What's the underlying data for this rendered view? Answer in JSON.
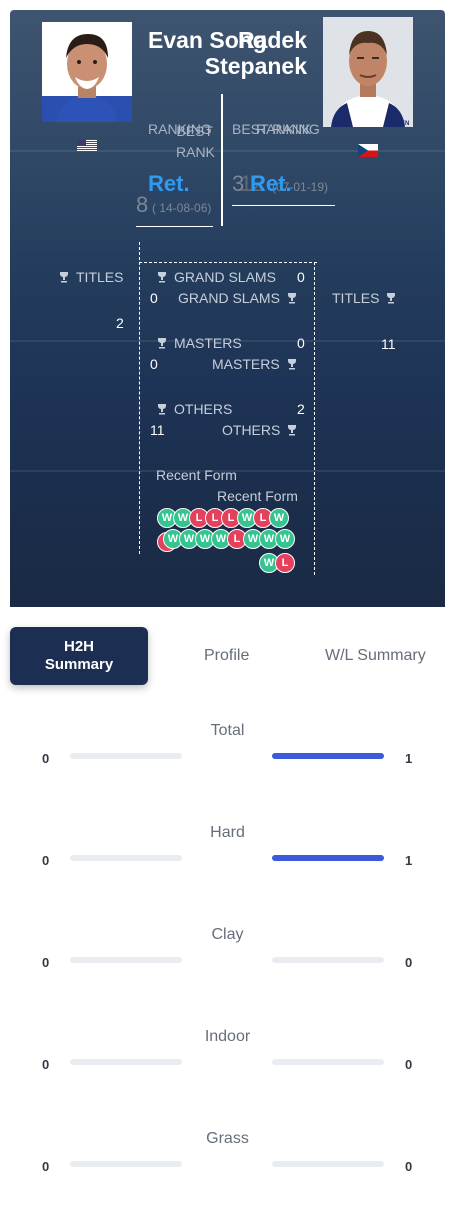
{
  "player1": {
    "name": "Evan Song",
    "flag_icon": "usa-flag-icon",
    "ranking_label": "RANKING",
    "ranking_value": "Ret.",
    "best_rank_label": "BEST RANK",
    "best_rank_value": "8",
    "best_rank_date": "( 14-08-06)",
    "titles_label": "TITLES",
    "titles_value": "2",
    "grand_slams_label": "GRAND SLAMS",
    "grand_slams_value": "0",
    "masters_label": "MASTERS",
    "masters_value": "0",
    "others_label": "OTHERS",
    "others_value": "2",
    "recent_form_label": "Recent Form",
    "recent_form": [
      "W",
      "W",
      "L",
      "L",
      "L",
      "W",
      "L",
      "W"
    ]
  },
  "player2": {
    "name_line1": "Radek",
    "name_line2": "Stepanek",
    "flag_icon": "czech-flag-icon",
    "ranking_label": "RANKING",
    "ranking_value": "Ret.",
    "best_rank_label": "BEST RANK",
    "best_rank_value": "3",
    "best_rank_date": "(07-01-19)",
    "best_rank_overlay": "12",
    "titles_label": "TITLES",
    "titles_value": "11",
    "grand_slams_label": "GRAND SLAMS",
    "grand_slams_value": "0",
    "masters_label": "MASTERS",
    "masters_value": "0",
    "others_label": "OTHERS",
    "others_value": "11",
    "recent_form_label": "Recent Form",
    "recent_form_row1": [
      "W",
      "W",
      "W",
      "W",
      "L",
      "W",
      "W",
      "W"
    ],
    "recent_form_row2": [
      "W",
      "L"
    ]
  },
  "tabs": {
    "active": "H2H Summary",
    "profile": "Profile",
    "wl_summary": "W/L Summary"
  },
  "h2h": [
    {
      "label": "Total",
      "left": "0",
      "right": "1",
      "left_frac": 0,
      "right_frac": 1
    },
    {
      "label": "Hard",
      "left": "0",
      "right": "1",
      "left_frac": 0,
      "right_frac": 1
    },
    {
      "label": "Clay",
      "left": "0",
      "right": "0",
      "left_frac": 0,
      "right_frac": 0
    },
    {
      "label": "Indoor",
      "left": "0",
      "right": "0",
      "left_frac": 0,
      "right_frac": 0
    },
    {
      "label": "Grass",
      "left": "0",
      "right": "0",
      "left_frac": 0,
      "right_frac": 0
    }
  ],
  "colors": {
    "win": "#35c48f",
    "loss": "#e5405c",
    "accent_blue": "#2e9bf0",
    "bar_fill": "#3b5bdb"
  }
}
